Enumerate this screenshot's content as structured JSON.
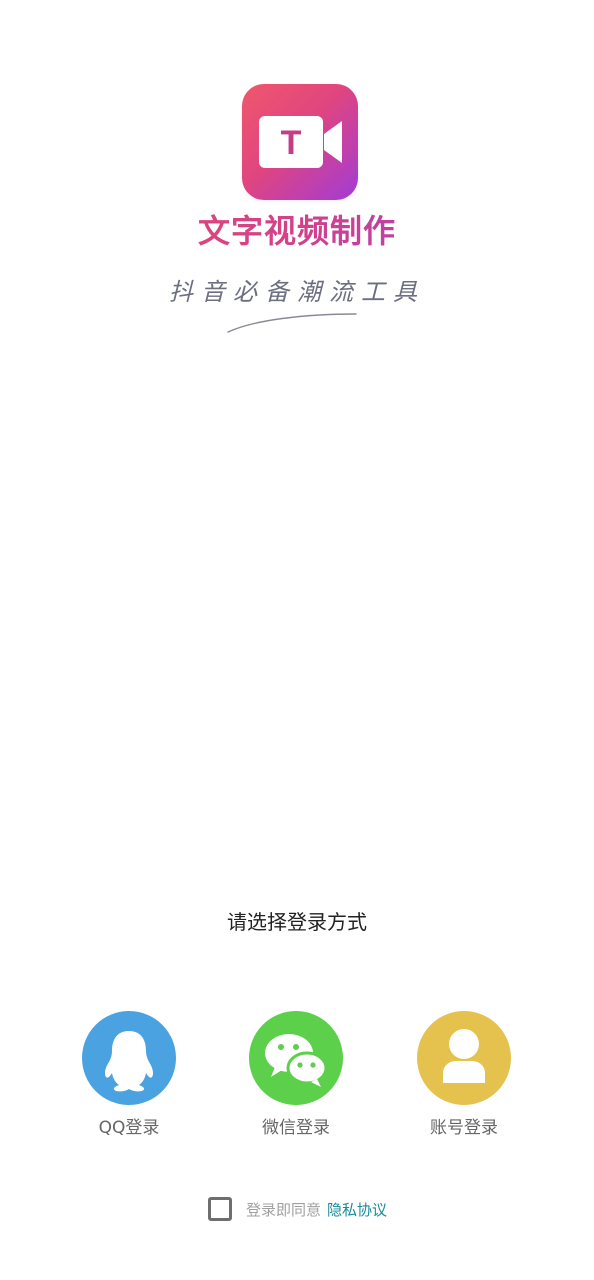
{
  "app": {
    "name": "文字视频制作",
    "slogan": "抖音必备潮流工具",
    "icon_letter": "T"
  },
  "login": {
    "prompt": "请选择登录方式",
    "options": [
      {
        "label": "QQ登录",
        "icon": "qq-penguin-icon",
        "color": "#4aa3e0"
      },
      {
        "label": "微信登录",
        "icon": "wechat-icon",
        "color": "#5ccf4b"
      },
      {
        "label": "账号登录",
        "icon": "user-account-icon",
        "color": "#e5c24e"
      }
    ]
  },
  "agreement": {
    "checked": false,
    "text": "登录即同意",
    "link_label": "隐私协议",
    "link_color": "#1b8a9a"
  }
}
